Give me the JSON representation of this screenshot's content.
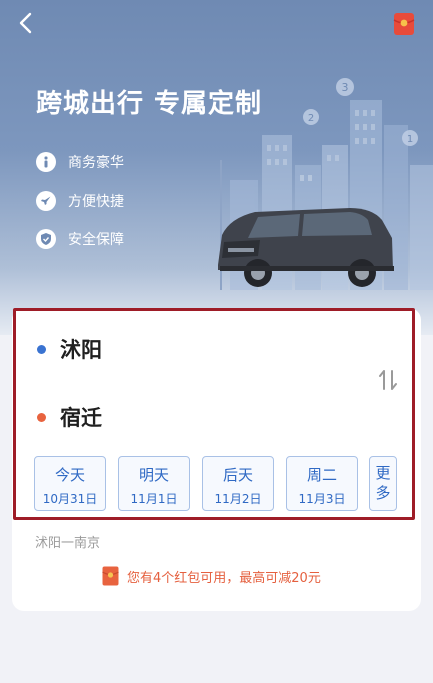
{
  "hero": {
    "title": "跨城出行  专属定制",
    "features": [
      {
        "label": "商务豪华",
        "icon": "diamond-icon"
      },
      {
        "label": "方便快捷",
        "icon": "rocket-icon"
      },
      {
        "label": "安全保障",
        "icon": "shield-icon"
      }
    ],
    "map_markers": [
      "3",
      "2",
      "1"
    ]
  },
  "route": {
    "from": "沭阳",
    "to": "宿迁",
    "from_dot_color": "#3a73d1",
    "to_dot_color": "#e8633f"
  },
  "dates": [
    {
      "day": "今天",
      "date": "10月31日"
    },
    {
      "day": "明天",
      "date": "11月1日"
    },
    {
      "day": "后天",
      "date": "11月2日"
    },
    {
      "day": "周二",
      "date": "11月3日"
    }
  ],
  "more_label": "更多",
  "history_route": "沭阳一南京",
  "promo_text": "您有4个红包可用，最高可减20元",
  "colors": {
    "accent_blue": "#2f69c4",
    "promo_red": "#e5603f",
    "highlight_border": "#9e1c27"
  }
}
